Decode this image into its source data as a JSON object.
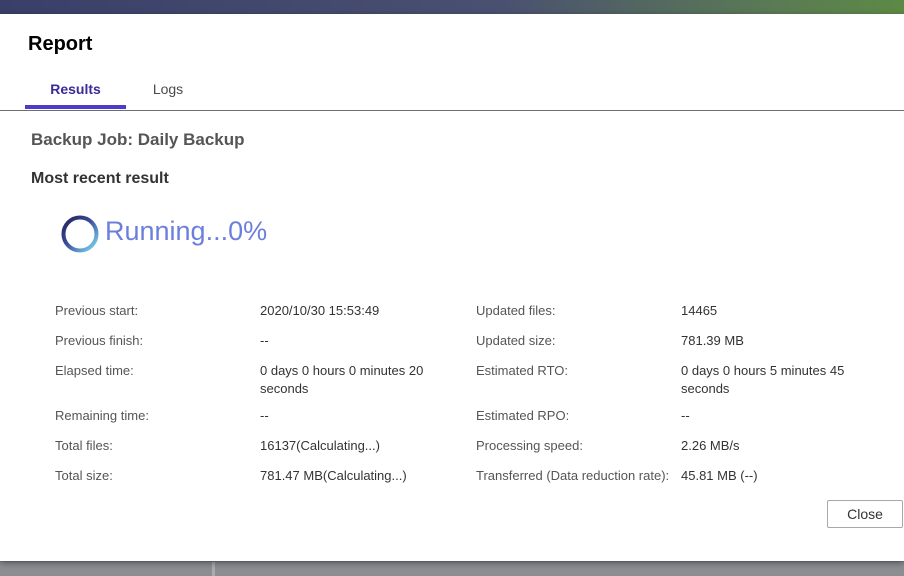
{
  "dialog": {
    "title": "Report",
    "close_label": "Close"
  },
  "tabs": [
    {
      "label": "Results",
      "active": true
    },
    {
      "label": "Logs",
      "active": false
    }
  ],
  "job": {
    "title": "Backup Job: Daily Backup"
  },
  "result": {
    "heading": "Most recent result",
    "status_text": "Running...0%",
    "progress_percent": 0
  },
  "details_left": [
    {
      "label": "Previous start:",
      "value": "2020/10/30 15:53:49"
    },
    {
      "label": "Previous finish:",
      "value": "--"
    },
    {
      "label": "Elapsed time:",
      "value": "0 days 0 hours 0 minutes 20 seconds"
    },
    {
      "label": "Remaining time:",
      "value": "--"
    },
    {
      "label": "Total files:",
      "value": "16137(Calculating...)"
    },
    {
      "label": "Total size:",
      "value": "781.47 MB(Calculating...)"
    }
  ],
  "details_right": [
    {
      "label": "Updated files:",
      "value": "14465"
    },
    {
      "label": "Updated size:",
      "value": "781.39 MB"
    },
    {
      "label": "Estimated RTO:",
      "value": "0 days 0 hours 5 minutes 45 seconds"
    },
    {
      "label": "Estimated RPO:",
      "value": "--"
    },
    {
      "label": "Processing speed:",
      "value": "2.26 MB/s"
    },
    {
      "label": "Transferred (Data reduction rate):",
      "value": "45.81 MB (--)"
    }
  ],
  "colors": {
    "accent": "#4d3cc9",
    "running_text": "#6c7fdd",
    "spinner_dark": "#2b2f6b",
    "spinner_light": "#6fd2f0"
  },
  "icons": {
    "spinner": "loading-spinner-icon"
  }
}
